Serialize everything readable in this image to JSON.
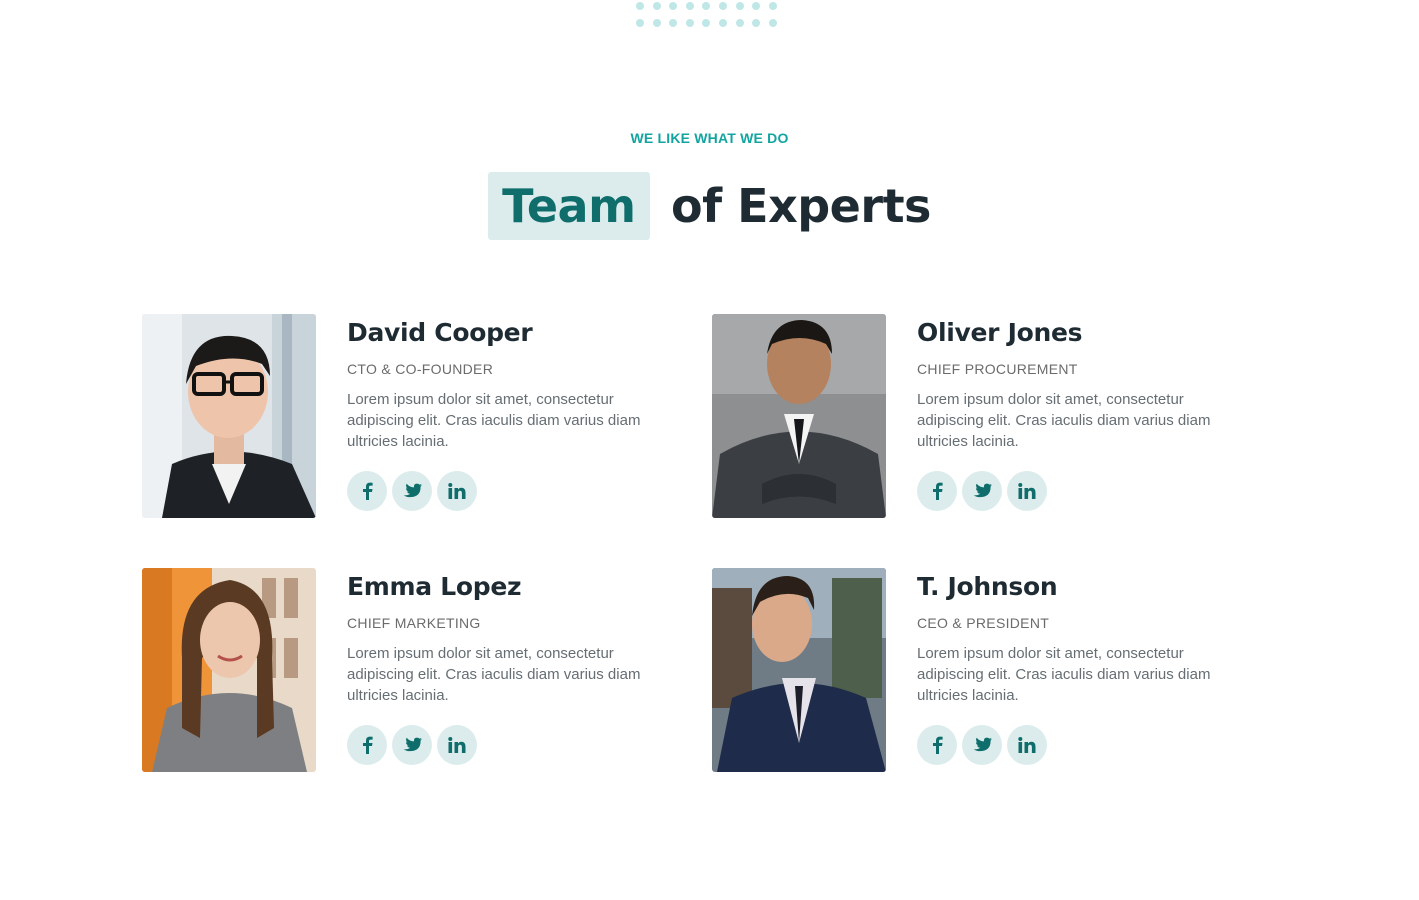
{
  "section": {
    "eyebrow": "WE LIKE WHAT WE DO",
    "title_highlight": "Team",
    "title_rest": "of Experts"
  },
  "colors": {
    "accent": "#12a5a0",
    "accent_dark": "#0f6e6b",
    "highlight_bg": "#dcecec",
    "heading": "#1f2b33"
  },
  "team": [
    {
      "name": "David Cooper",
      "role": "CTO & CO-FOUNDER",
      "bio": "Lorem ipsum dolor sit amet, consectetur adipiscing elit. Cras iaculis diam varius diam ultricies lacinia.",
      "socials": [
        "facebook-icon",
        "twitter-icon",
        "linkedin-icon"
      ]
    },
    {
      "name": "Oliver Jones",
      "role": "CHIEF PROCUREMENT",
      "bio": "Lorem ipsum dolor sit amet, consectetur adipiscing elit. Cras iaculis diam varius diam ultricies lacinia.",
      "socials": [
        "facebook-icon",
        "twitter-icon",
        "linkedin-icon"
      ]
    },
    {
      "name": "Emma Lopez",
      "role": "CHIEF MARKETING",
      "bio": "Lorem ipsum dolor sit amet, consectetur adipiscing elit. Cras iaculis diam varius diam ultricies lacinia.",
      "socials": [
        "facebook-icon",
        "twitter-icon",
        "linkedin-icon"
      ]
    },
    {
      "name": "T. Johnson",
      "role": "CEO & PRESIDENT",
      "bio": "Lorem ipsum dolor sit amet, consectetur adipiscing elit. Cras iaculis diam varius diam ultricies lacinia.",
      "socials": [
        "facebook-icon",
        "twitter-icon",
        "linkedin-icon"
      ]
    }
  ]
}
